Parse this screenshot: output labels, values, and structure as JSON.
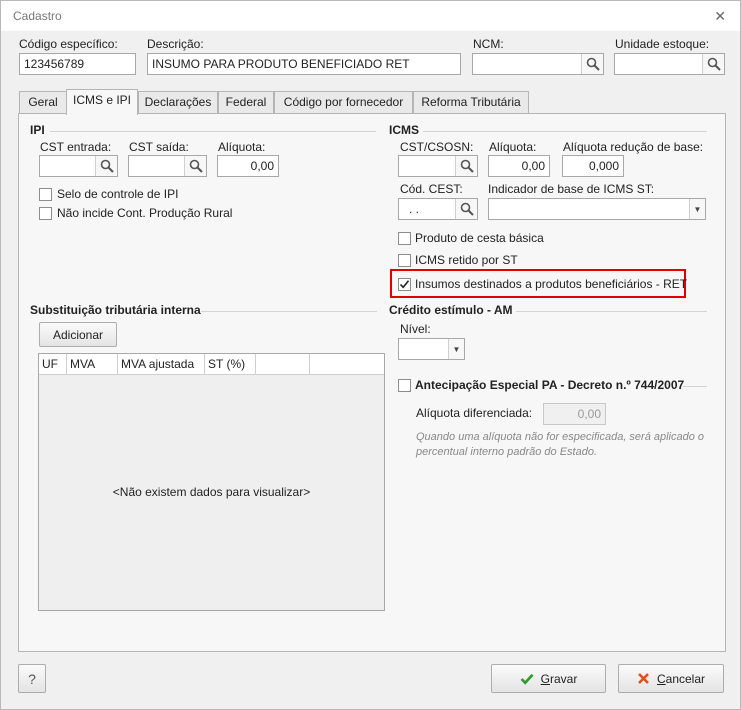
{
  "window": {
    "title": "Cadastro"
  },
  "header": {
    "codigo_label": "Código específico:",
    "codigo_value": "123456789",
    "descricao_label": "Descrição:",
    "descricao_value": "INSUMO PARA PRODUTO BENEFICIADO RET",
    "ncm_label": "NCM:",
    "ncm_value": "",
    "unidade_label": "Unidade estoque:",
    "unidade_value": ""
  },
  "tabs": [
    {
      "label": "Geral",
      "active": false
    },
    {
      "label": "ICMS e IPI",
      "active": true
    },
    {
      "label": "Declarações",
      "active": false
    },
    {
      "label": "Federal",
      "active": false
    },
    {
      "label": "Código por fornecedor",
      "active": false
    },
    {
      "label": "Reforma Tributária",
      "active": false
    }
  ],
  "ipi": {
    "title": "IPI",
    "cst_entrada_label": "CST entrada:",
    "cst_entrada_value": "",
    "cst_saida_label": "CST saída:",
    "cst_saida_value": "",
    "aliquota_label": "Alíquota:",
    "aliquota_value": "0,00",
    "selo_label": "Selo de controle de IPI",
    "selo_checked": false,
    "nao_incide_label": "Não incide Cont. Produção Rural",
    "nao_incide_checked": false
  },
  "icms": {
    "title": "ICMS",
    "cst_csosn_label": "CST/CSOSN:",
    "cst_csosn_value": "",
    "aliquota_label": "Alíquota:",
    "aliquota_value": "0,00",
    "reducao_label": "Alíquota redução de base:",
    "reducao_value": "0,000",
    "cest_label": "Cód. CEST:",
    "cest_value": ".   .",
    "indicador_label": "Indicador de base de ICMS ST:",
    "indicador_value": "",
    "cesta_basica_label": "Produto de cesta básica",
    "cesta_basica_checked": false,
    "icms_retido_label": "ICMS retido por ST",
    "icms_retido_checked": false,
    "insumos_label": "Insumos destinados a produtos beneficiários - RET",
    "insumos_checked": true
  },
  "st_interna": {
    "title": "Substituição tributária interna",
    "adicionar_label": "Adicionar",
    "columns": [
      "UF",
      "MVA",
      "MVA ajustada",
      "ST (%)"
    ],
    "empty_text": "<Não existem dados para visualizar>"
  },
  "credito": {
    "title": "Crédito estímulo - AM",
    "nivel_label": "Nível:",
    "nivel_value": ""
  },
  "antecipacao": {
    "label": "Antecipação Especial PA - Decreto n.º 744/2007",
    "checked": false,
    "aliquota_label": "Alíquota diferenciada:",
    "aliquota_value": "0,00",
    "note": "Quando uma alíquota não for especificada, será aplicado o percentual interno padrão do Estado."
  },
  "footer": {
    "help_label": "?",
    "gravar_label": "Gravar",
    "cancelar_label": "Cancelar"
  },
  "colors": {
    "highlight": "#e00000",
    "check": "#2e9a2e",
    "cancel": "#e0501c"
  },
  "icons": {
    "lookup": "magnifier-icon",
    "save": "check-icon",
    "cancel": "x-icon",
    "close": "close-icon"
  }
}
